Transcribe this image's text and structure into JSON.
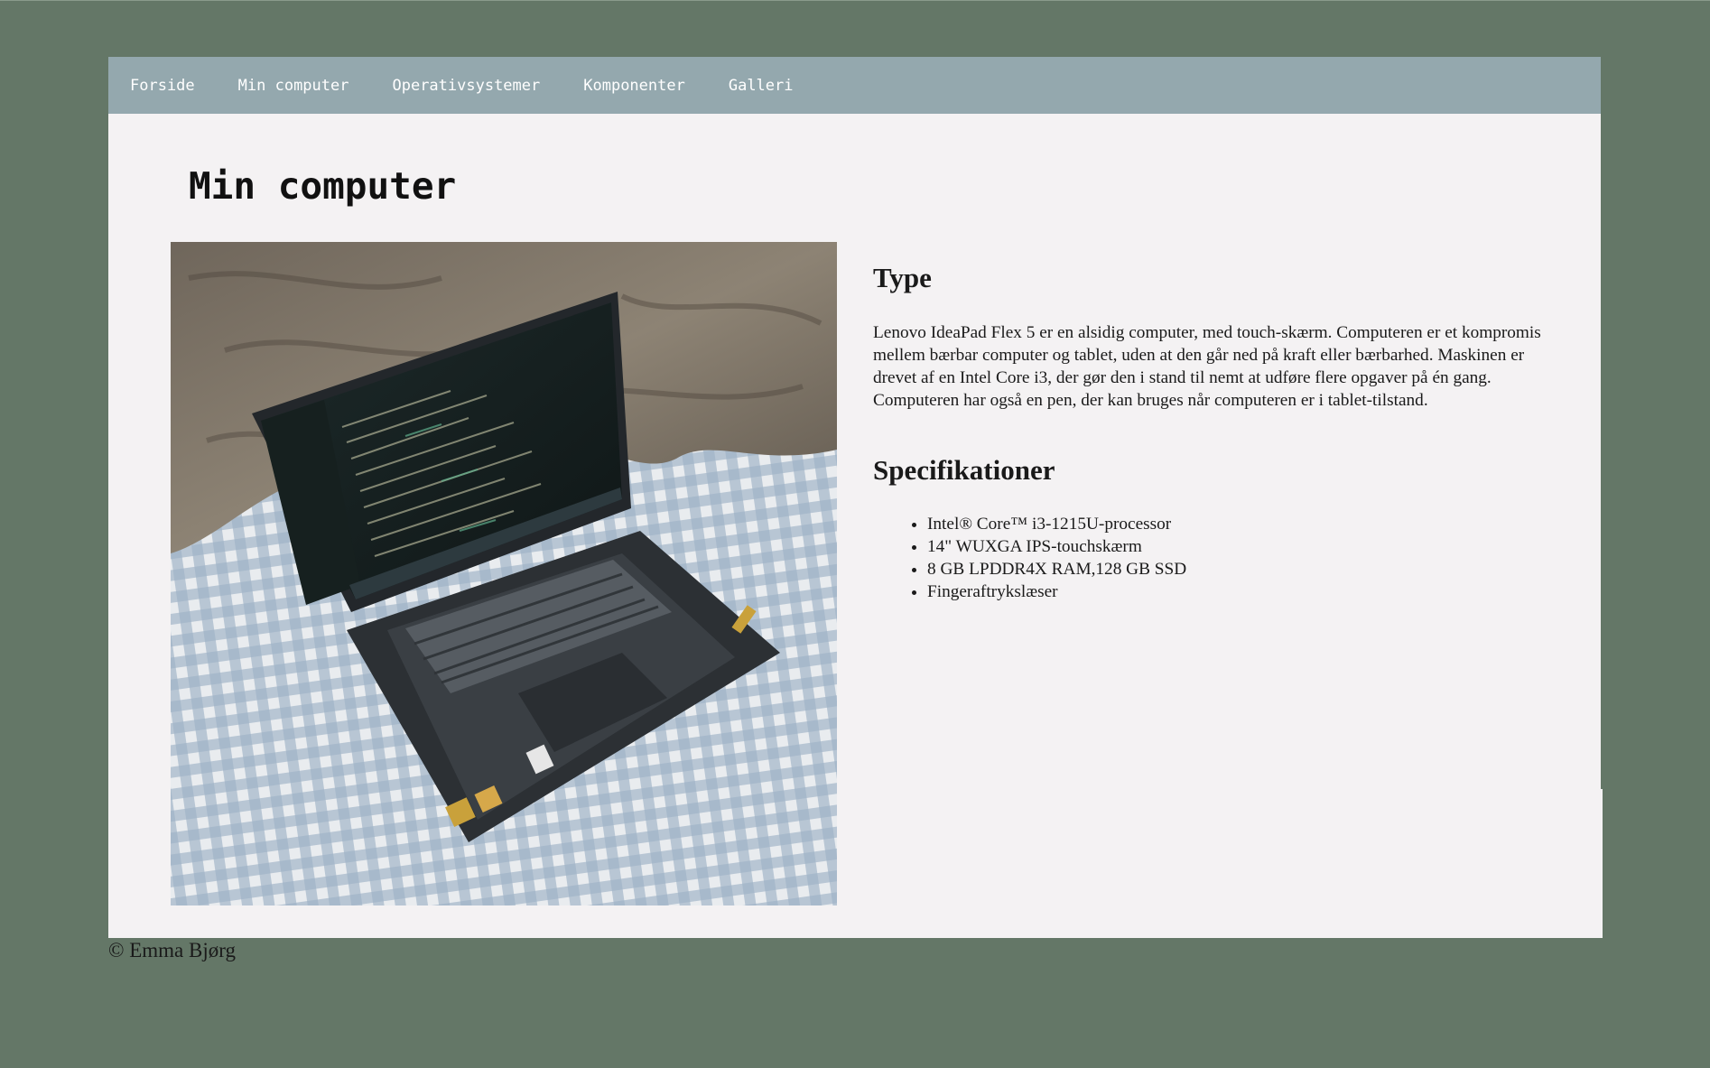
{
  "nav": {
    "items": [
      {
        "label": "Forside"
      },
      {
        "label": "Min computer"
      },
      {
        "label": "Operativsystemer"
      },
      {
        "label": "Komponenter"
      },
      {
        "label": "Galleri"
      }
    ]
  },
  "main": {
    "title": "Min computer",
    "image": {
      "icon": "laptop-photo"
    },
    "type": {
      "heading": "Type",
      "text": "Lenovo IdeaPad Flex 5 er en alsidig computer, med touch-skærm. Computeren er et kompromis mellem bærbar computer og tablet, uden at den går ned på kraft eller bærbarhed. Maskinen er drevet af en Intel Core i3, der gør den i stand til nemt at udføre flere opgaver på én gang. Computeren har også en pen, der kan bruges når computeren er i tablet-tilstand."
    },
    "specs": {
      "heading": "Specifikationer",
      "items": [
        "Intel® Core™ i3-1215U-processor",
        "14\" WUXGA IPS-touchskærm",
        "8 GB LPDDR4X RAM,128 GB SSD",
        "Fingeraftrykslæser"
      ]
    }
  },
  "footer": {
    "copyright": "© Emma Bjørg"
  },
  "colors": {
    "page_background": "#647767",
    "nav_background": "#94a8ae",
    "content_background": "#f4f2f3",
    "text": "#1a1a1a"
  }
}
